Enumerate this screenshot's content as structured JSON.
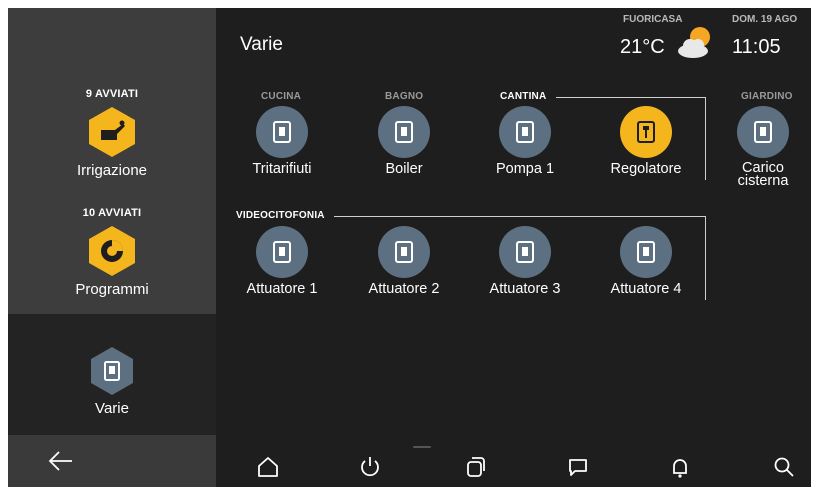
{
  "header": {
    "title": "Varie"
  },
  "weather": {
    "caption": "FUORICASA",
    "temperature": "21°C",
    "icon": "partly-cloudy-icon"
  },
  "clock": {
    "date": "DOM. 19 AGO",
    "time": "11:05"
  },
  "sidebar": {
    "categories": [
      {
        "count": "9 AVVIATI",
        "label": "Irrigazione",
        "icon": "watering-can-icon"
      },
      {
        "count": "10 AVVIATI",
        "label": "Programmi",
        "icon": "program-icon"
      },
      {
        "count": "",
        "label": "Varie",
        "icon": "switch-icon"
      }
    ]
  },
  "groups": {
    "cucina": "CUCINA",
    "bagno": "BAGNO",
    "cantina": "CANTINA",
    "giardino": "GIARDINO",
    "videocitofonia": "VIDEOCITOFONIA"
  },
  "devices": [
    {
      "label": "Tritarifiuti",
      "state": "off"
    },
    {
      "label": "Boiler",
      "state": "off"
    },
    {
      "label": "Pompa 1",
      "state": "off"
    },
    {
      "label": "Regolatore",
      "state": "on"
    },
    {
      "label": "Carico cisterna",
      "state": "off"
    },
    {
      "label": "Attuatore 1",
      "state": "off"
    },
    {
      "label": "Attuatore 2",
      "state": "off"
    },
    {
      "label": "Attuatore 3",
      "state": "off"
    },
    {
      "label": "Attuatore 4",
      "state": "off"
    }
  ],
  "nav": {
    "back": "back-arrow-icon",
    "items": [
      "home-icon",
      "power-icon",
      "scenes-icon",
      "messages-icon",
      "notifications-icon",
      "search-icon"
    ]
  },
  "colors": {
    "accent": "#f5b51d",
    "device_off": "#5c7081",
    "background": "#1e1e1e",
    "sidebar_active": "#3d3d3d"
  }
}
